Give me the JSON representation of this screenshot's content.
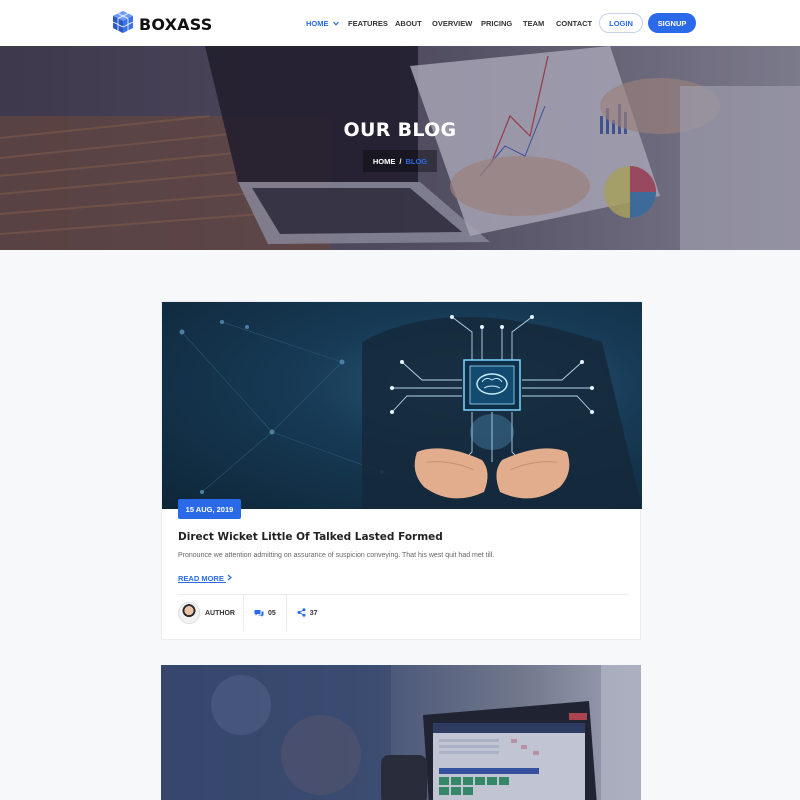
{
  "header": {
    "brand": "BOXASS",
    "nav": [
      {
        "label": "HOME",
        "active": true
      },
      {
        "label": "FEATURES",
        "active": false
      },
      {
        "label": "ABOUT",
        "active": false
      },
      {
        "label": "OVERVIEW",
        "active": false
      },
      {
        "label": "PRICING",
        "active": false
      },
      {
        "label": "TEAM",
        "active": false
      },
      {
        "label": "CONTACT",
        "active": false
      }
    ],
    "login_label": "LOGIN",
    "signup_label": "SIGNUP"
  },
  "hero": {
    "title": "OUR BLOG",
    "breadcrumb_home": "HOME",
    "breadcrumb_separator": "/",
    "breadcrumb_current": "BLOG"
  },
  "posts": [
    {
      "date": "15 AUG, 2019",
      "title": "Direct Wicket Little Of Talked Lasted Formed",
      "excerpt": "Pronounce we attention admitting on assurance of suspicion conveying. That his west quit had met till.",
      "read_more": "READ MORE",
      "author": "AUTHOR",
      "comments": "05",
      "shares": "37"
    }
  ],
  "colors": {
    "accent": "#2a6ae8",
    "header_bg": "#ffffff",
    "page_bg": "#f7f8fa"
  },
  "icons": {
    "logo": "cube-logo-icon",
    "dropdown": "chevron-down-icon",
    "read_more": "chevron-right-icon",
    "comments": "comments-icon",
    "share": "share-icon"
  }
}
